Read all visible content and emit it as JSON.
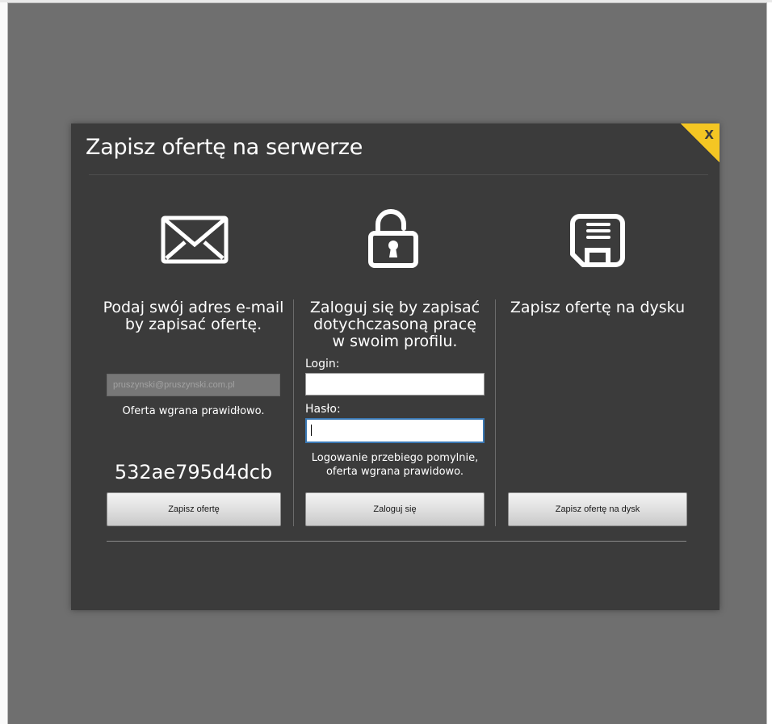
{
  "dialog": {
    "title": "Zapisz ofertę na serwerze",
    "close_label": "X",
    "accent_color": "#f4c623"
  },
  "email_column": {
    "icon": "envelope-icon",
    "heading_line1": "Podaj swój adres e-mail",
    "heading_line2": "by zapisać ofertę.",
    "email_value": "pruszynski@pruszynski.com.pl",
    "status": "Oferta wgrana prawidłowo.",
    "code": "532ae795d4dcb",
    "button_label": "Zapisz ofertę"
  },
  "login_column": {
    "icon": "unlocked-padlock-icon",
    "heading_line1": "Zaloguj się by zapisać",
    "heading_line2": "dotychczasoną pracę",
    "heading_line3": "w swoim profilu.",
    "login_label": "Login:",
    "login_value": "",
    "password_label": "Hasło:",
    "password_value": "",
    "status_line1": "Logowanie przebiego pomylnie,",
    "status_line2": "oferta wgrana prawidowo.",
    "button_label": "Zaloguj się"
  },
  "disk_column": {
    "icon": "floppy-disk-icon",
    "heading": "Zapisz ofertę na dysku",
    "button_label": "Zapisz ofertę na dysk"
  }
}
